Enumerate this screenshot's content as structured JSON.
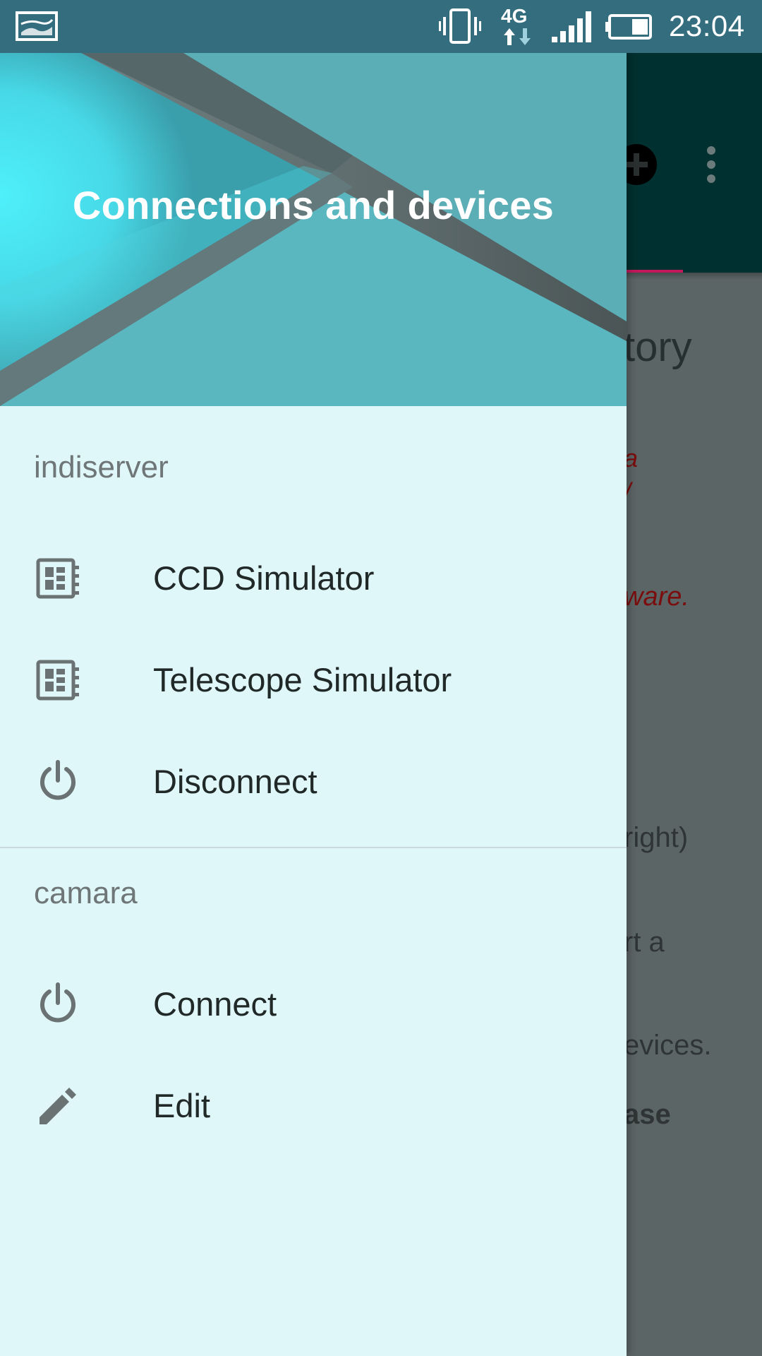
{
  "status_bar": {
    "time": "23:04",
    "network_type": "4G",
    "icons": [
      "gallery-icon",
      "vibrate-icon",
      "network-4g-icon",
      "signal-icon",
      "battery-icon"
    ]
  },
  "background_app": {
    "heading_fragment": "tory",
    "red_text_1": "a",
    "red_text_2": "/",
    "red_text_3": "ware.",
    "line_1": "right)",
    "line_2": "rt a",
    "line_3": "evices.",
    "line_4": "ase",
    "toolbar_icons": [
      "add-circle-icon",
      "more-vert-icon"
    ]
  },
  "drawer": {
    "header_title": "Connections and devices",
    "sections": [
      {
        "title": "indiserver",
        "items": [
          {
            "label": "CCD Simulator",
            "icon": "device-icon"
          },
          {
            "label": "Telescope Simulator",
            "icon": "device-icon"
          },
          {
            "label": "Disconnect",
            "icon": "power-icon"
          }
        ]
      },
      {
        "title": "camara",
        "items": [
          {
            "label": "Connect",
            "icon": "power-icon"
          },
          {
            "label": "Edit",
            "icon": "pencil-icon"
          }
        ]
      }
    ]
  },
  "colors": {
    "status_bar": "#336d7e",
    "drawer_background": "#e0f7f9",
    "header_teal": "#5bb9c2",
    "icon_gray": "#6b7273",
    "text_dark": "#202828"
  }
}
